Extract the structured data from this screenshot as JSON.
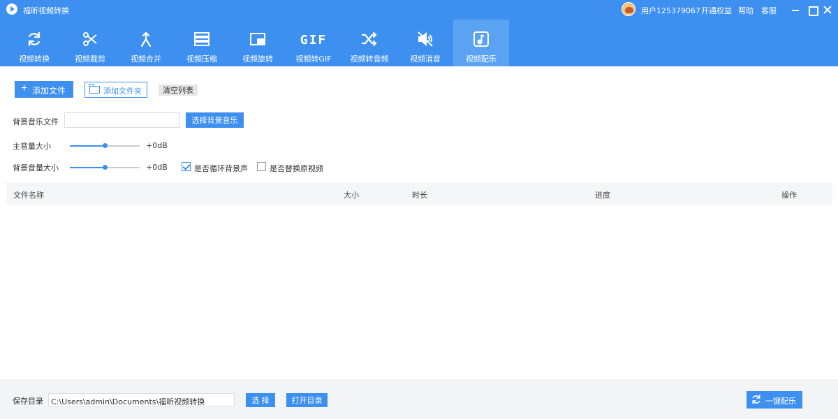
{
  "app": {
    "title": "福昕视频转换"
  },
  "user": {
    "name": "用户125379067"
  },
  "header_links": {
    "vip": "开通权益",
    "help": "帮助",
    "service": "客服"
  },
  "tabs": [
    {
      "label": "视频转换",
      "icon": "refresh-icon"
    },
    {
      "label": "视频裁剪",
      "icon": "scissors-icon"
    },
    {
      "label": "视频合并",
      "icon": "merge-icon"
    },
    {
      "label": "视频压缩",
      "icon": "compress-icon"
    },
    {
      "label": "视频旋转",
      "icon": "rotate-icon"
    },
    {
      "label": "视频转GIF",
      "icon": "gif-icon",
      "glyph": "GIF"
    },
    {
      "label": "视频转音频",
      "icon": "shuffle-icon"
    },
    {
      "label": "视频消音",
      "icon": "mute-icon"
    },
    {
      "label": "视频配乐",
      "icon": "music-icon",
      "active": true
    }
  ],
  "actions": {
    "add_file": "添加文件",
    "add_folder": "添加文件夹",
    "clear_list": "清空列表"
  },
  "form": {
    "bgm_label": "背景音乐文件",
    "bgm_value": "",
    "select_bgm": "选择背景音乐",
    "main_volume_label": "主音量大小",
    "main_volume_value": "+0dB",
    "main_volume_level": 0.5,
    "bg_volume_label": "背景音量大小",
    "bg_volume_value": "+0dB",
    "bg_volume_level": 0.5,
    "loop_label": "是否循环背景声",
    "loop_checked": true,
    "replace_label": "是否替换原视频",
    "replace_checked": false
  },
  "table": {
    "columns": [
      "文件名称",
      "大小",
      "时长",
      "进度",
      "操作"
    ],
    "rows": []
  },
  "footer": {
    "save_label": "保存目录",
    "save_path": "C:\\Users\\admin\\Documents\\福昕视频转换",
    "choose": "选 择",
    "open_dir": "打开目录",
    "one_click": "一键配乐"
  },
  "colors": {
    "accent": "#3d8ff0",
    "header": "#3d8ff0",
    "active_tab": "#5aa3f3"
  }
}
